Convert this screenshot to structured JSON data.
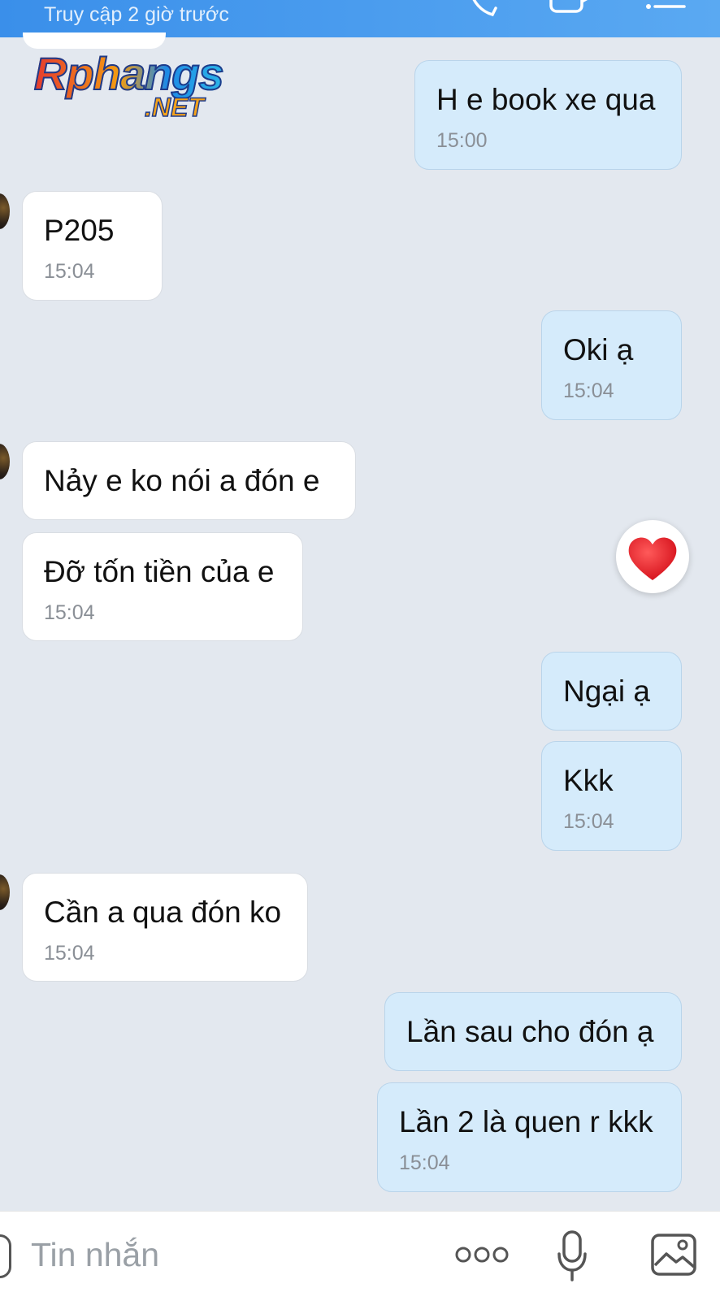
{
  "header": {
    "status": "Truy cập 2 giờ trước",
    "icons": [
      "phone-icon",
      "video-icon",
      "menu-icon"
    ]
  },
  "watermark": {
    "main": "Rphangs",
    "sub": ".NET"
  },
  "messages": [
    {
      "side": "out",
      "text": "H e book xe qua",
      "time": "15:00"
    },
    {
      "side": "in",
      "text": "P205",
      "time": "15:04"
    },
    {
      "side": "out",
      "text": "Oki ạ",
      "time": "15:04"
    },
    {
      "side": "in",
      "text": "Nảy e ko nói a đón e"
    },
    {
      "side": "in",
      "text": "Đỡ tốn tiền của e",
      "time": "15:04"
    },
    {
      "side": "out",
      "text": "Ngại ạ"
    },
    {
      "side": "out",
      "text": "Kkk",
      "time": "15:04"
    },
    {
      "side": "in",
      "text": "Cần a qua đón ko",
      "time": "15:04"
    },
    {
      "side": "out",
      "text": "Lần sau cho đón ạ"
    },
    {
      "side": "out",
      "text": "Lần 2 là quen r kkk",
      "time": "15:04"
    }
  ],
  "reaction": {
    "icon": "heart-icon",
    "color": "#e0151f"
  },
  "composer": {
    "placeholder": "Tin nhắn",
    "icons": [
      "more-icon",
      "microphone-icon",
      "image-icon"
    ]
  },
  "colors": {
    "header": "#3a8fea",
    "background": "#e3e8ef",
    "outgoing": "#d5ebfb",
    "incoming": "#ffffff"
  }
}
